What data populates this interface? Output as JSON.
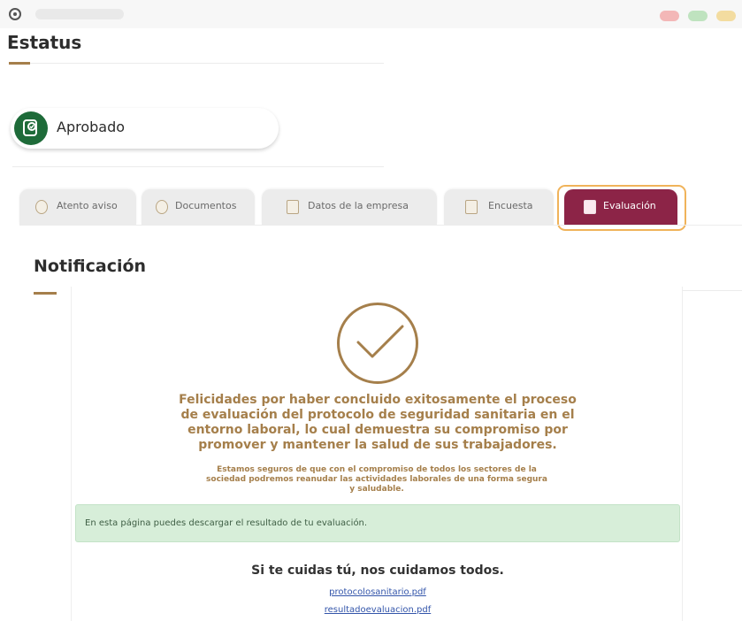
{
  "header": {
    "title": "Estatus"
  },
  "status": {
    "label": "Aprobado",
    "icon": "document-check-icon"
  },
  "tabs": [
    {
      "label": "Atento aviso",
      "icon": "info-icon"
    },
    {
      "label": "Documentos",
      "icon": "info-icon"
    },
    {
      "label": "Datos de la empresa",
      "icon": "building-icon"
    },
    {
      "label": "Encuesta",
      "icon": "clipboard-icon"
    },
    {
      "label": "Evaluación",
      "icon": "document-icon",
      "active": true
    }
  ],
  "section": {
    "title": "Notificación"
  },
  "notification": {
    "main_lines": [
      "Felicidades por haber concluido exitosamente el proceso",
      "de evaluación del protocolo de seguridad sanitaria en el",
      "entorno laboral, lo cual demuestra su compromiso por",
      "promover y mantener la salud de sus trabajadores."
    ],
    "sub_lines": [
      "Estamos seguros de que con el compromiso de todos los sectores de la",
      "sociedad podremos reanudar las actividades laborales de una forma segura",
      "y saludable."
    ],
    "alert": "En esta página puedes descargar el resultado de tu evaluación.",
    "slogan": "Si te cuidas tú, nos cuidamos todos.",
    "links": [
      "protocolosanitario.pdf",
      "resultadoevaluacion.pdf"
    ]
  },
  "colors": {
    "accent_gold": "#a57f4b",
    "active_tab": "#8c2447",
    "approved_green": "#1e6b39",
    "alert_bg": "#d7eed9",
    "highlight": "#f0b35a"
  }
}
